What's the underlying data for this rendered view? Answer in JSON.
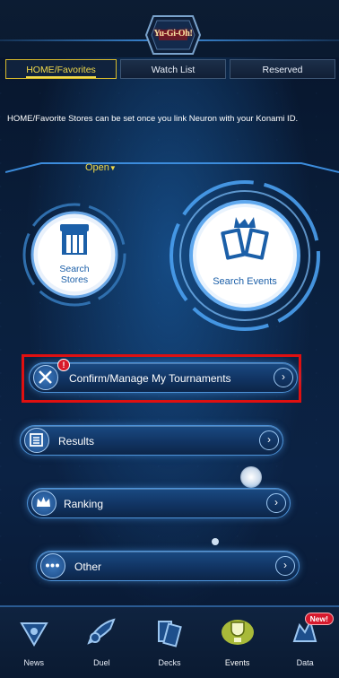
{
  "header": {
    "logo_text": "Yu-Gi-Oh!"
  },
  "tabs": [
    {
      "label": "HOME/Favorites",
      "active": true
    },
    {
      "label": "Watch List",
      "active": false
    },
    {
      "label": "Reserved",
      "active": false
    }
  ],
  "notice": "HOME/Favorite Stores can be set once you link Neuron with your Konami ID.",
  "open_toggle": {
    "label": "Open"
  },
  "search": {
    "stores_label_line1": "Search",
    "stores_label_line2": "Stores",
    "events_label": "Search Events"
  },
  "menu": {
    "manage": {
      "label": "Confirm/Manage My Tournaments",
      "badge": "!"
    },
    "results": {
      "label": "Results"
    },
    "ranking": {
      "label": "Ranking"
    },
    "other": {
      "label": "Other"
    }
  },
  "nav": {
    "news": "News",
    "duel": "Duel",
    "decks": "Decks",
    "events": "Events",
    "data": "Data",
    "data_badge": "New!"
  },
  "colors": {
    "accent_yellow": "#f1d94a",
    "highlight_red": "#e01010",
    "button_blue": "#113463",
    "glow_blue": "#4d93d9"
  }
}
